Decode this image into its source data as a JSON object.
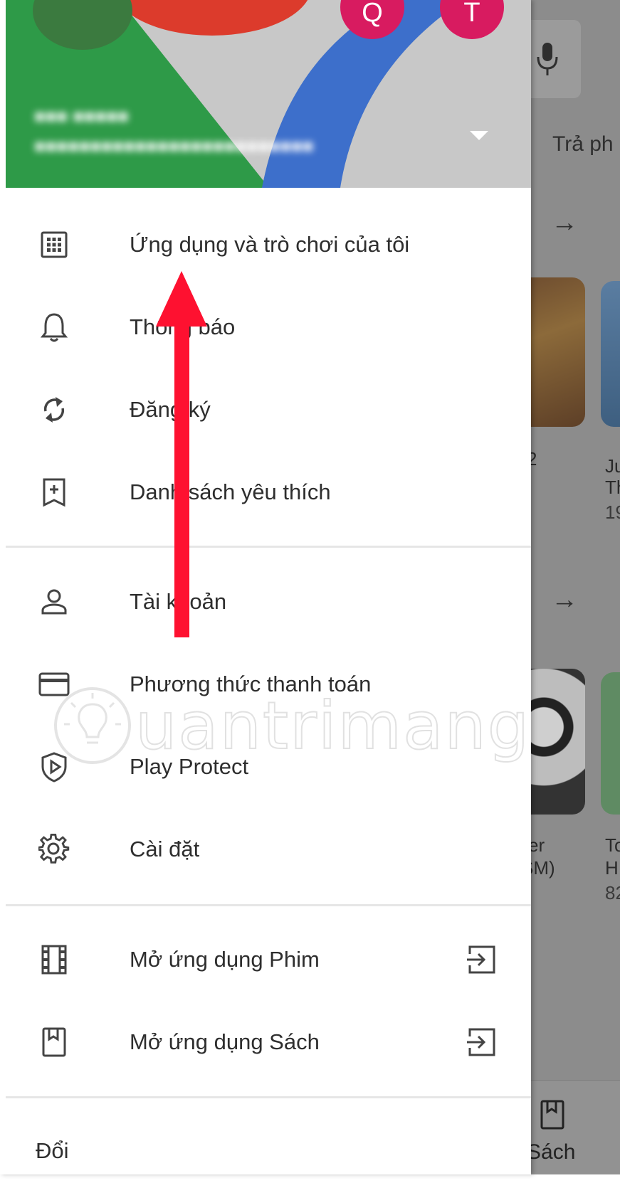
{
  "background": {
    "tab_partial": "Trả ph",
    "card_texts": [
      "2",
      "Ju",
      "Th",
      "19",
      "er",
      "SM)",
      "To",
      "H",
      "82"
    ],
    "bottom_nav_label": "Sách"
  },
  "drawer": {
    "menu_group1": [
      {
        "label": "Ứng dụng và trò chơi của tôi",
        "icon": "apps-grid-icon"
      },
      {
        "label": "Thông báo",
        "icon": "bell-icon"
      },
      {
        "label": "Đăng ký",
        "icon": "sync-icon"
      },
      {
        "label": "Danh sách yêu thích",
        "icon": "bookmark-add-icon"
      }
    ],
    "menu_group2": [
      {
        "label": "Tài khoản",
        "icon": "person-icon"
      },
      {
        "label": "Phương thức thanh toán",
        "icon": "credit-card-icon"
      },
      {
        "label": "Play Protect",
        "icon": "shield-play-icon"
      },
      {
        "label": "Cài đặt",
        "icon": "gear-icon"
      }
    ],
    "menu_group3": [
      {
        "label": "Mở ứng dụng Phim",
        "icon": "film-icon",
        "trailing_icon": "open-app-icon"
      },
      {
        "label": "Mở ứng dụng Sách",
        "icon": "book-icon",
        "trailing_icon": "open-app-icon"
      }
    ],
    "bottom_partial": "Đổi"
  },
  "watermark": {
    "text": "uantrimang",
    "lead": "Q"
  },
  "annotation": {
    "color": "#fe1130"
  },
  "colors": {
    "green": "#2e9a48",
    "blue": "#3d6fcb",
    "red": "#dc3b2c",
    "pink": "#d81b60",
    "overlay": "#8c8c8c"
  }
}
